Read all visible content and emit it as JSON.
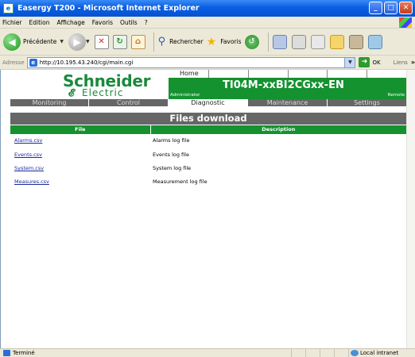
{
  "window": {
    "title": "Easergy T200 - Microsoft Internet Explorer"
  },
  "menu": {
    "items": [
      "Fichier",
      "Edition",
      "Affichage",
      "Favoris",
      "Outils",
      "?"
    ]
  },
  "toolbar": {
    "back_label": "Précédente",
    "search_label": "Rechercher",
    "favorites_label": "Favoris"
  },
  "address": {
    "label": "Adresse",
    "url": "http://10.195.43.240/cgi/main.cgi",
    "go_label": "OK",
    "links_label": "Liens"
  },
  "page": {
    "logo_main": "Schneider",
    "logo_sub": "Electric",
    "home_tab": "Home",
    "device_name": "TI04M-xxBI2CGxx-EN",
    "user": "Administrator",
    "mode": "Remote",
    "nav": [
      {
        "label": "Monitoring"
      },
      {
        "label": "Control"
      },
      {
        "label": "Diagnostic"
      },
      {
        "label": "Maintenance"
      },
      {
        "label": "Settings"
      }
    ],
    "section_title": "Files download",
    "columns": {
      "file": "File",
      "description": "Description"
    },
    "files": [
      {
        "name": "Alarms.csv",
        "description": "Alarms log file"
      },
      {
        "name": "Events.csv",
        "description": "Events log file"
      },
      {
        "name": "System.csv",
        "description": "System log file"
      },
      {
        "name": "Measures.csv",
        "description": "Measurement log file"
      }
    ]
  },
  "status": {
    "text": "Terminé",
    "zone": "Local intranet"
  }
}
